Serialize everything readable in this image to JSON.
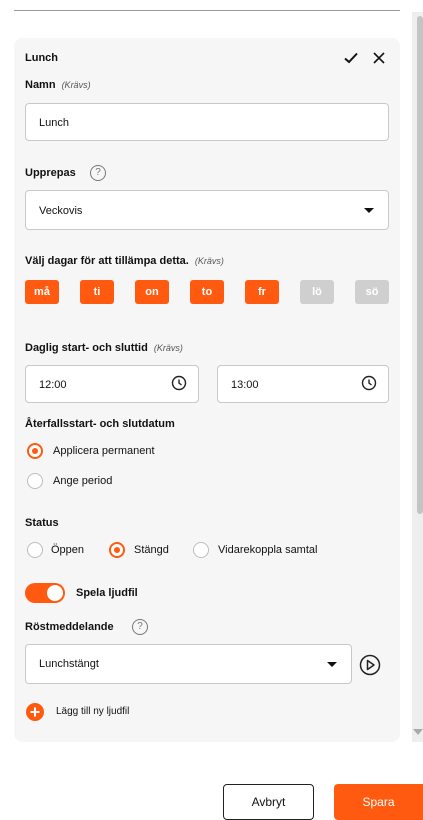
{
  "form": {
    "title": "Lunch",
    "name_label": "Namn",
    "required": "(Krävs)",
    "name_value": "Lunch",
    "repeat_label": "Upprepas",
    "repeat_value": "Veckovis",
    "days_label": "Välj dagar för att tillämpa detta.",
    "days": [
      {
        "label": "må",
        "active": true
      },
      {
        "label": "ti",
        "active": true
      },
      {
        "label": "on",
        "active": true
      },
      {
        "label": "to",
        "active": true
      },
      {
        "label": "fr",
        "active": true
      },
      {
        "label": "lö",
        "active": false
      },
      {
        "label": "sö",
        "active": false
      }
    ],
    "daily_label": "Daglig start- och sluttid",
    "start_time": "12:00",
    "end_time": "13:00",
    "recurrence_label": "Återfallsstart- och slutdatum",
    "recurrence_options": [
      "Applicera permanent",
      "Ange period"
    ],
    "recurrence_selected": "Applicera permanent",
    "status_label": "Status",
    "status_options": [
      "Öppen",
      "Stängd",
      "Vidarekoppla samtal"
    ],
    "status_selected": "Stängd",
    "play_audio_label": "Spela ljudfil",
    "play_audio_on": true,
    "voice_label": "Röstmeddelande",
    "voice_value": "Lunchstängt",
    "add_audio_label": "Lägg till ny ljudfil"
  },
  "actions": {
    "cancel": "Avbryt",
    "save": "Spara"
  },
  "colors": {
    "accent": "#ff5a0f",
    "day_inactive": "#cfcfcf",
    "card_bg": "#f6f6f6"
  },
  "icons": [
    "check-icon",
    "close-icon",
    "help-icon",
    "chevron-down-icon",
    "clock-icon",
    "play-icon",
    "plus-icon"
  ]
}
